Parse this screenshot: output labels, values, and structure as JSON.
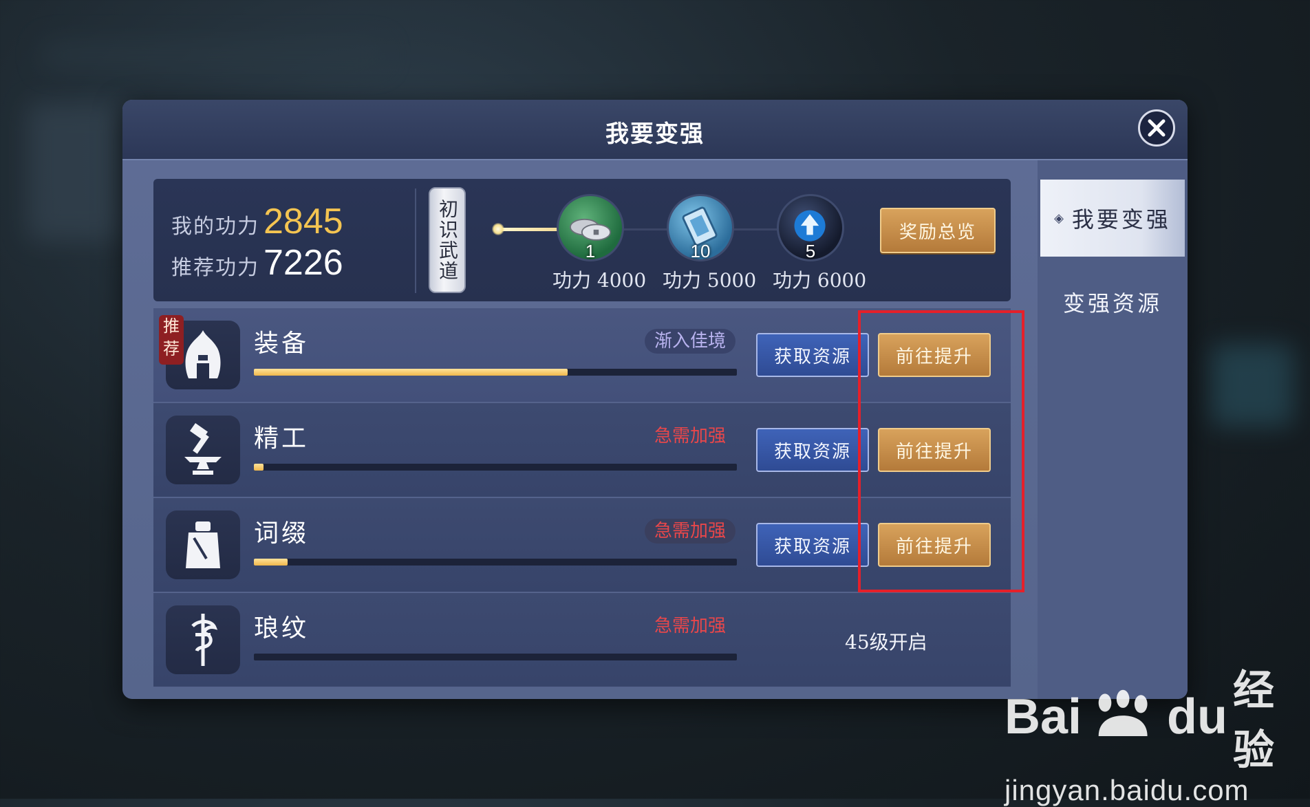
{
  "dialog": {
    "title": "我要变强"
  },
  "side_tabs": [
    {
      "label": "我要变强",
      "active": true
    },
    {
      "label": "变强资源",
      "active": false
    }
  ],
  "summary": {
    "my_power_label": "我的功力",
    "my_power_value": "2845",
    "recommended_label": "推荐功力",
    "recommended_value": "7226",
    "stage_label": "初识武道",
    "milestones": [
      {
        "qty": "1",
        "label": "功力 4000",
        "icon": "coins-icon"
      },
      {
        "qty": "10",
        "label": "功力 5000",
        "icon": "scroll-ticket-icon"
      },
      {
        "qty": "5",
        "label": "功力 6000",
        "icon": "upgrade-orb-icon"
      }
    ],
    "reward_button": "奖励总览"
  },
  "rows": [
    {
      "name": "装备",
      "badge": "推荐",
      "status": "渐入佳境",
      "status_kind": "good",
      "progress": 0.65,
      "get_label": "获取资源",
      "go_label": "前往提升",
      "icon": "helmet-icon"
    },
    {
      "name": "精工",
      "status": "急需加强",
      "status_kind": "urgent",
      "progress": 0.02,
      "get_label": "获取资源",
      "go_label": "前往提升",
      "icon": "anvil-hammer-icon"
    },
    {
      "name": "词缀",
      "status": "急需加强",
      "status_kind": "urgent",
      "progress": 0.07,
      "get_label": "获取资源",
      "go_label": "前往提升",
      "icon": "armor-icon"
    },
    {
      "name": "琅纹",
      "status": "急需加强",
      "status_kind": "urgent",
      "progress": 0.0,
      "locked_text": "45级开启",
      "icon": "dragon-sword-icon"
    }
  ],
  "watermark": {
    "brand_left": "Bai",
    "brand_mid": "du",
    "brand_cn": "经验",
    "url": "jingyan.baidu.com"
  },
  "colors": {
    "accent_gold": "#f4c451",
    "urgent_red": "#e9474a",
    "annotation_red": "#e5202a"
  }
}
